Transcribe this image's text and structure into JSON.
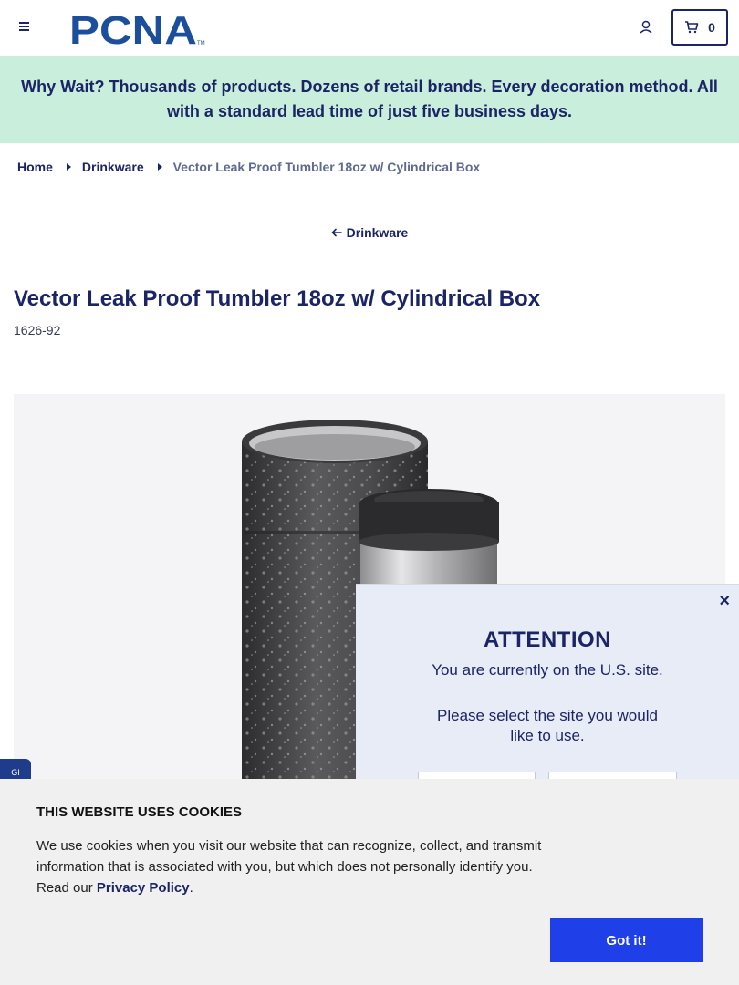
{
  "header": {
    "logo_text": "PCNA",
    "cart_count": "0"
  },
  "banner": {
    "text": "Why Wait? Thousands of products. Dozens of retail brands. Every decoration method. All with a standard lead time of just five business days."
  },
  "breadcrumb": {
    "items": [
      "Home",
      "Drinkware"
    ],
    "current": "Vector Leak Proof Tumbler 18oz w/ Cylindrical Box"
  },
  "back_link": {
    "label": "Drinkware"
  },
  "product": {
    "title": "Vector Leak Proof Tumbler 18oz w/ Cylindrical Box",
    "sku": "1626-92"
  },
  "feedback_tab": {
    "label": "GI"
  },
  "attention_modal": {
    "close": "×",
    "title": "ATTENTION",
    "line1": "You are currently on the U.S. site.",
    "line2": "Please select the site you would like to use."
  },
  "cookie_banner": {
    "title": "THIS WEBSITE USES COOKIES",
    "text_before_link": "We use cookies when you visit our website that can recognize, collect, and transmit information that is associated with you, but which does not personally identify you. Read our ",
    "link_text": "Privacy Policy",
    "text_after_link": ".",
    "button_label": "Got it!"
  },
  "colors": {
    "brand_navy": "#1b2466",
    "banner_bg": "#c9eedb",
    "cookie_button": "#1f40e8"
  }
}
